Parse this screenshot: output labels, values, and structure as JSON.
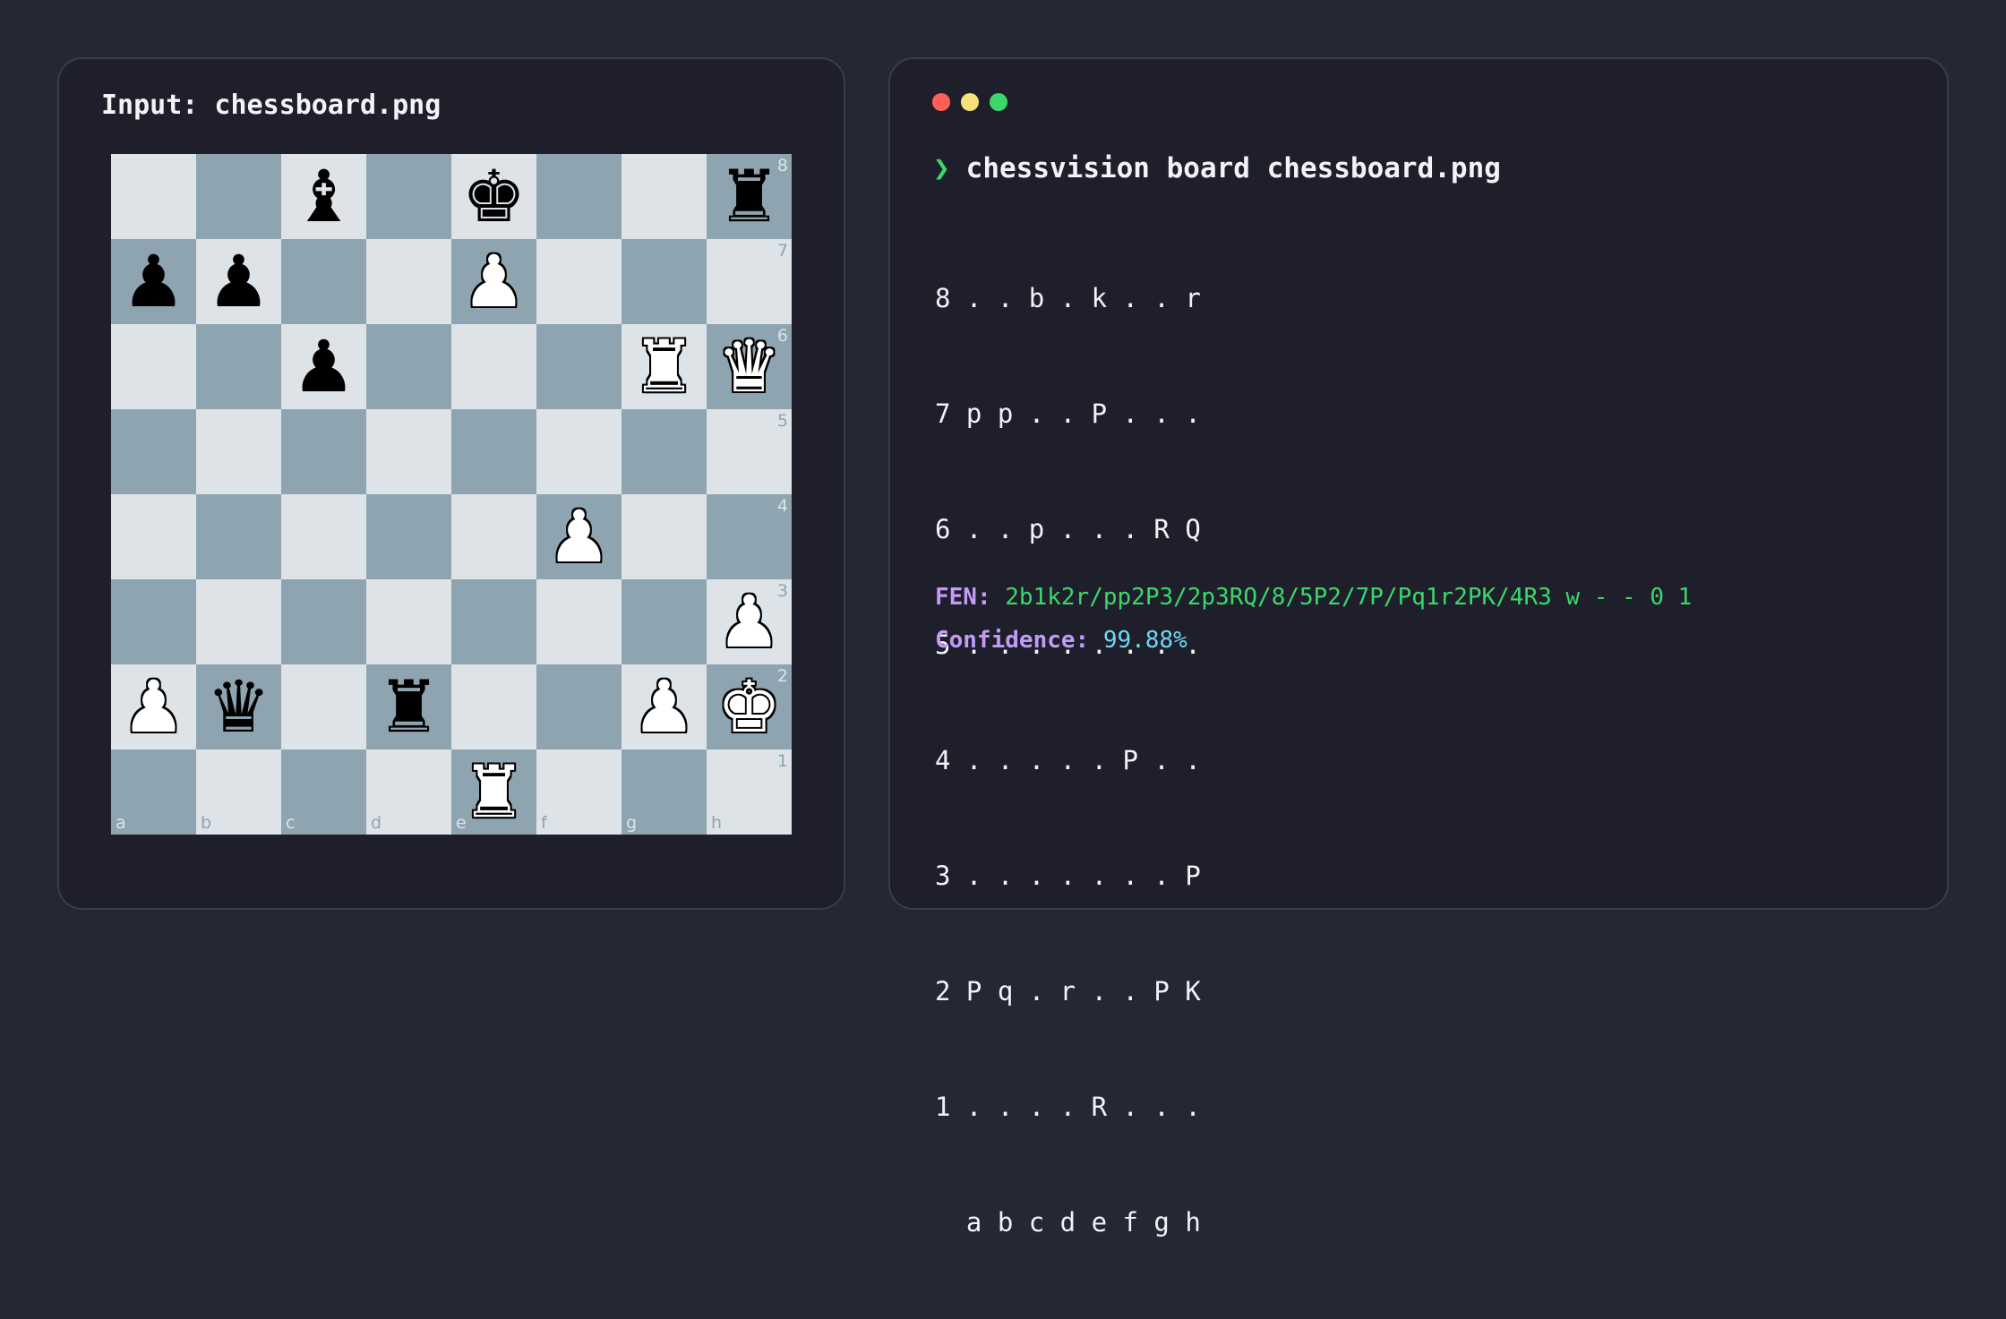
{
  "left_panel": {
    "title": "Input: chessboard.png",
    "board": {
      "rows": [
        [
          "",
          "",
          "b",
          "",
          "k",
          "",
          "",
          "r"
        ],
        [
          "p",
          "p",
          "",
          "",
          "P",
          "",
          "",
          ""
        ],
        [
          "",
          "",
          "p",
          "",
          "",
          "",
          "R",
          "Q"
        ],
        [
          "",
          "",
          "",
          "",
          "",
          "",
          "",
          ""
        ],
        [
          "",
          "",
          "",
          "",
          "",
          "P",
          "",
          ""
        ],
        [
          "",
          "",
          "",
          "",
          "",
          "",
          "",
          "P"
        ],
        [
          "P",
          "q",
          "",
          "r",
          "",
          "",
          "P",
          "K"
        ],
        [
          "",
          "",
          "",
          "",
          "R",
          "",
          "",
          ""
        ]
      ],
      "rank_labels": [
        "8",
        "7",
        "6",
        "5",
        "4",
        "3",
        "2",
        "1"
      ],
      "file_labels": [
        "a",
        "b",
        "c",
        "d",
        "e",
        "f",
        "g",
        "h"
      ],
      "light_color": "#dee3e8",
      "dark_color": "#8ea4b0"
    }
  },
  "terminal": {
    "window_buttons": [
      "close",
      "minimize",
      "maximize"
    ],
    "prompt_symbol": "❯",
    "command": "chessvision board chessboard.png",
    "ascii_board": [
      "8 . . b . k . . r",
      "7 p p . . P . . .",
      "6 . . p . . . R Q",
      "5 . . . . . . . .",
      "4 . . . . . P . .",
      "3 . . . . . . . P",
      "2 P q . r . . P K",
      "1 . . . . R . . .",
      "  a b c d e f g h"
    ],
    "fen_label": "FEN:",
    "fen_value": "2b1k2r/pp2P3/2p3RQ/8/5P2/7P/Pq1r2PK/4R3 w - - 0 1",
    "confidence_label": "Confidence:",
    "confidence_value": "99.88%"
  },
  "colors": {
    "background": "#252734",
    "panel": "#1e1f2b",
    "prompt_green": "#3ad86b",
    "label_purple": "#c39bf7",
    "value_cyan": "#6fd7ee"
  }
}
